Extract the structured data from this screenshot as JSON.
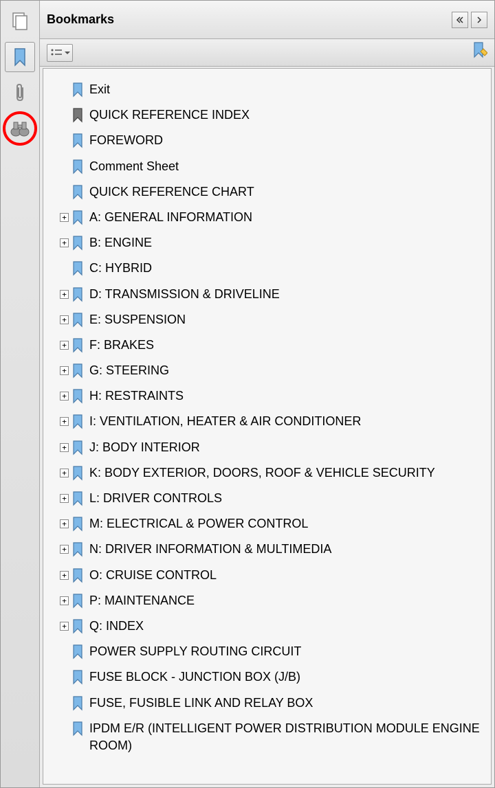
{
  "header": {
    "title": "Bookmarks"
  },
  "bookmarks": [
    {
      "label": "Exit",
      "expandable": false,
      "dark": false
    },
    {
      "label": "QUICK REFERENCE INDEX",
      "expandable": false,
      "dark": true
    },
    {
      "label": "FOREWORD",
      "expandable": false,
      "dark": false
    },
    {
      "label": "Comment Sheet",
      "expandable": false,
      "dark": false
    },
    {
      "label": "QUICK REFERENCE CHART",
      "expandable": false,
      "dark": false
    },
    {
      "label": "A: GENERAL INFORMATION",
      "expandable": true,
      "dark": false
    },
    {
      "label": "B: ENGINE",
      "expandable": true,
      "dark": false
    },
    {
      "label": "C: HYBRID",
      "expandable": false,
      "dark": false
    },
    {
      "label": "D: TRANSMISSION & DRIVELINE",
      "expandable": true,
      "dark": false
    },
    {
      "label": "E: SUSPENSION",
      "expandable": true,
      "dark": false
    },
    {
      "label": "F: BRAKES",
      "expandable": true,
      "dark": false
    },
    {
      "label": "G: STEERING",
      "expandable": true,
      "dark": false
    },
    {
      "label": "H: RESTRAINTS",
      "expandable": true,
      "dark": false
    },
    {
      "label": "I: VENTILATION, HEATER & AIR CONDITIONER",
      "expandable": true,
      "dark": false
    },
    {
      "label": "J: BODY INTERIOR",
      "expandable": true,
      "dark": false
    },
    {
      "label": "K: BODY EXTERIOR, DOORS, ROOF & VEHICLE SECURITY",
      "expandable": true,
      "dark": false
    },
    {
      "label": "L: DRIVER CONTROLS",
      "expandable": true,
      "dark": false
    },
    {
      "label": "M: ELECTRICAL & POWER CONTROL",
      "expandable": true,
      "dark": false
    },
    {
      "label": "N: DRIVER INFORMATION & MULTIMEDIA",
      "expandable": true,
      "dark": false
    },
    {
      "label": "O: CRUISE CONTROL",
      "expandable": true,
      "dark": false
    },
    {
      "label": "P: MAINTENANCE",
      "expandable": true,
      "dark": false
    },
    {
      "label": "Q: INDEX",
      "expandable": true,
      "dark": false
    },
    {
      "label": "POWER SUPPLY ROUTING CIRCUIT",
      "expandable": false,
      "dark": false
    },
    {
      "label": "FUSE BLOCK - JUNCTION BOX (J/B)",
      "expandable": false,
      "dark": false
    },
    {
      "label": "FUSE, FUSIBLE LINK AND RELAY BOX",
      "expandable": false,
      "dark": false
    },
    {
      "label": "IPDM E/R (INTELLIGENT POWER DISTRIBUTION MODULE ENGINE ROOM)",
      "expandable": false,
      "dark": false
    }
  ]
}
